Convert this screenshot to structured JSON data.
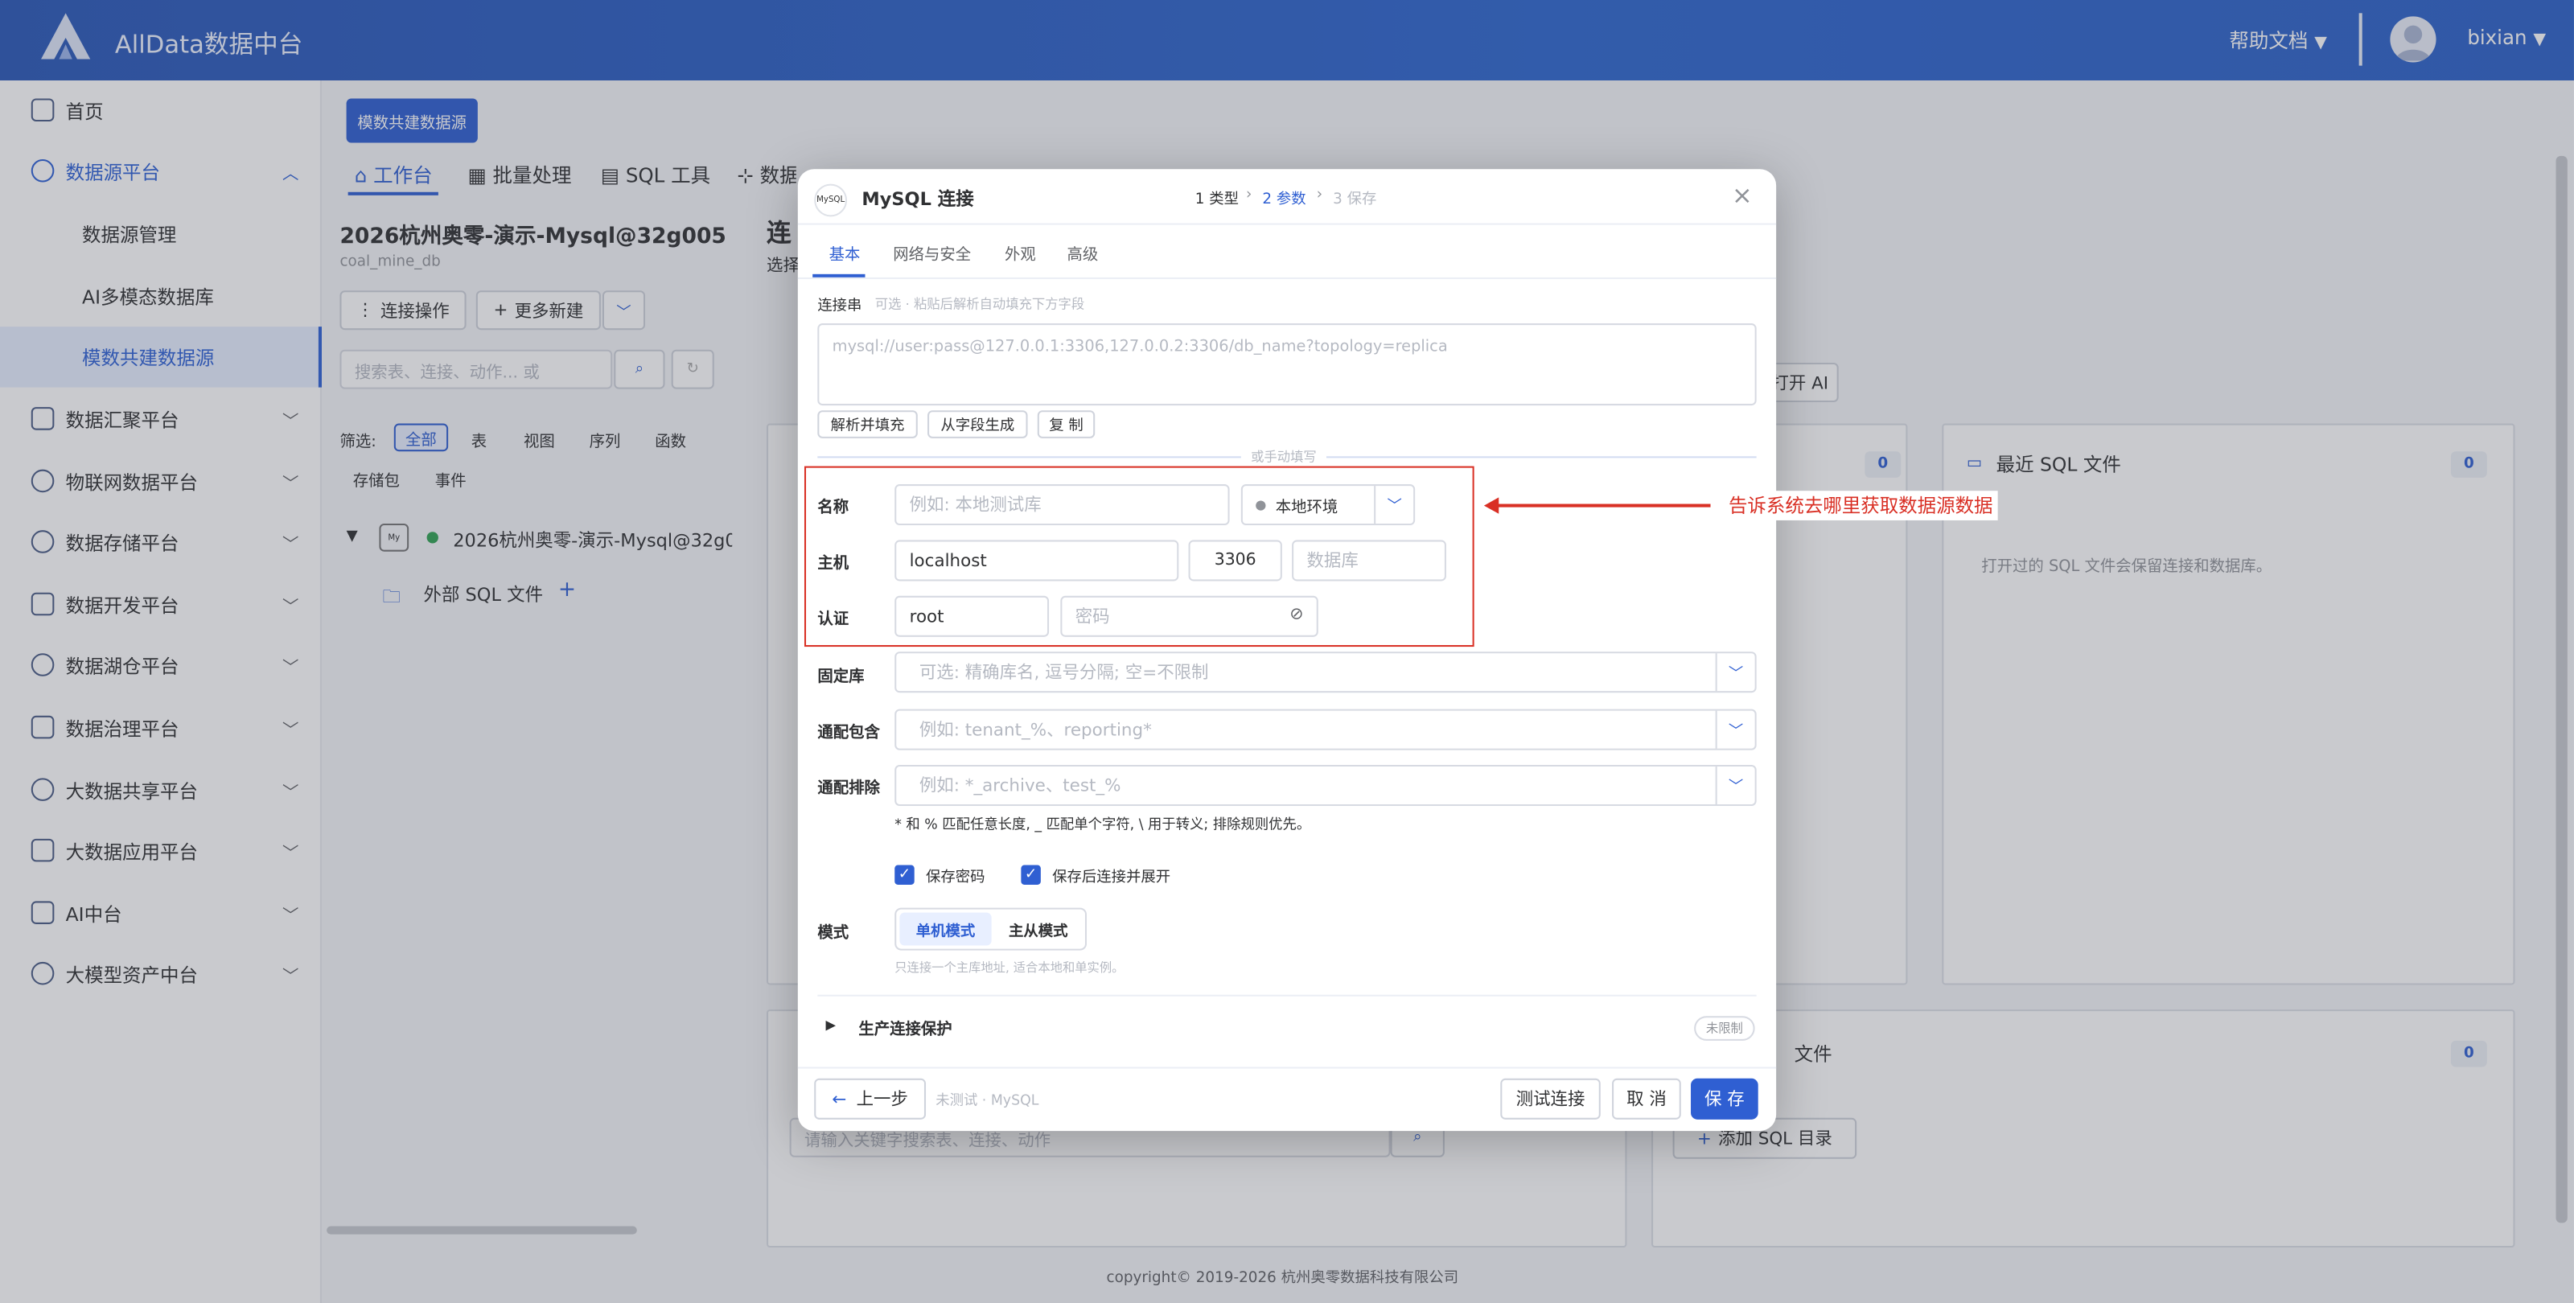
{
  "header": {
    "brand": "AllData数据中台",
    "help": "帮助文档",
    "help_caret": "▼",
    "user": "bixian",
    "user_caret": "▼"
  },
  "sidebar": {
    "items": [
      {
        "label": "首页",
        "icon": "home-icon"
      },
      {
        "label": "数据源平台",
        "icon": "database-icon",
        "expanded": true
      },
      {
        "label": "数据汇聚平台",
        "icon": "layers-icon"
      },
      {
        "label": "物联网数据平台",
        "icon": "iot-icon"
      },
      {
        "label": "数据存储平台",
        "icon": "storage-icon"
      },
      {
        "label": "数据开发平台",
        "icon": "grid-icon"
      },
      {
        "label": "数据湖仓平台",
        "icon": "lake-icon"
      },
      {
        "label": "数据治理平台",
        "icon": "governance-icon"
      },
      {
        "label": "大数据共享平台",
        "icon": "share-icon"
      },
      {
        "label": "大数据应用平台",
        "icon": "cube-icon"
      },
      {
        "label": "AI中台",
        "icon": "ai-icon"
      },
      {
        "label": "大模型资产中台",
        "icon": "model-icon"
      }
    ],
    "sub_items": [
      "数据源管理",
      "AI多模态数据库",
      "模数共建数据源"
    ],
    "active_sub": "模数共建数据源"
  },
  "main": {
    "page_button": "模数共建数据源",
    "tabs": [
      "工作台",
      "批量处理",
      "SQL 工具",
      "数据源"
    ],
    "conn_title": "2026杭州奥零-演示-Mysql@32g005",
    "conn_db": "coal_mine_db",
    "conn_ops": "连接操作",
    "more_new": "更多新建",
    "search_placeholder": "搜索表、连接、动作... 或",
    "filter_label": "筛选:",
    "filters": [
      "全部",
      "表",
      "视图",
      "序列",
      "函数",
      "存储包",
      "事件"
    ],
    "tree_conn": "2026杭州奥零-演示-Mysql@32g0",
    "tree_ext": "外部 SQL 文件",
    "tree_add": "+",
    "right_title_partial": "连",
    "right_sub_partial": "选择",
    "open_ai": "打开 AI",
    "recent_title": "最近 SQL 文件",
    "recent_count": "0",
    "recent_empty": "打开过的 SQL 文件会保留连接和数据库。",
    "panel_count": "0",
    "files_title": "文件",
    "files_count": "0",
    "add_sql_dir": "添加 SQL 目录",
    "bottom_search_placeholder": "请输入关键字搜索表、连接、动作",
    "copyright": "copyright© 2019-2026 杭州奥零数据科技有限公司"
  },
  "modal": {
    "logo_text": "MySQL",
    "title": "MySQL 连接",
    "steps": [
      "1 类型",
      "2 参数",
      "3 保存"
    ],
    "active_step": "2 参数",
    "close": "×",
    "tabs": [
      "基本",
      "网络与安全",
      "外观",
      "高级"
    ],
    "active_tab": "基本",
    "conn_string_label": "连接串",
    "conn_string_hint": "可选 · 粘贴后解析自动填充下方字段",
    "conn_string_placeholder": "mysql://user:pass@127.0.0.1:3306,127.0.0.2:3306/db_name?topology=replica",
    "btn_parse": "解析并填充",
    "btn_gen": "从字段生成",
    "btn_copy": "复 制",
    "divider_text": "或手动填写",
    "name_label": "名称",
    "name_placeholder": "例如: 本地测试库",
    "env_value": "本地环境",
    "host_label": "主机",
    "host_value": "localhost",
    "port_value": "3306",
    "db_placeholder": "数据库",
    "auth_label": "认证",
    "user_value": "root",
    "pwd_placeholder": "密码",
    "fixed_db_label": "固定库",
    "fixed_db_placeholder": "可选: 精确库名, 逗号分隔; 空=不限制",
    "include_label": "通配包含",
    "include_placeholder": "例如: tenant_%、reporting*",
    "exclude_label": "通配排除",
    "exclude_placeholder": "例如: *_archive、test_%",
    "wildcard_note": "* 和 % 匹配任意长度, _ 匹配单个字符, \\ 用于转义; 排除规则优先。",
    "save_pwd": "保存密码",
    "expand_after_save": "保存后连接并展开",
    "mode_label": "模式",
    "mode_single": "单机模式",
    "mode_ms": "主从模式",
    "mode_note": "只连接一个主库地址, 适合本地和单实例。",
    "prod_protect": "生产连接保护",
    "unlimited": "未限制",
    "prev": "上一步",
    "status": "未测试 · MySQL",
    "test": "测试连接",
    "cancel": "取 消",
    "save": "保 存"
  },
  "annotation": {
    "text": "告诉系统去哪里获取数据源数据",
    "color": "#d93025"
  },
  "colors": {
    "primary": "#2f5fd2",
    "header": "#2d5fc6",
    "annotation": "#d93025"
  }
}
